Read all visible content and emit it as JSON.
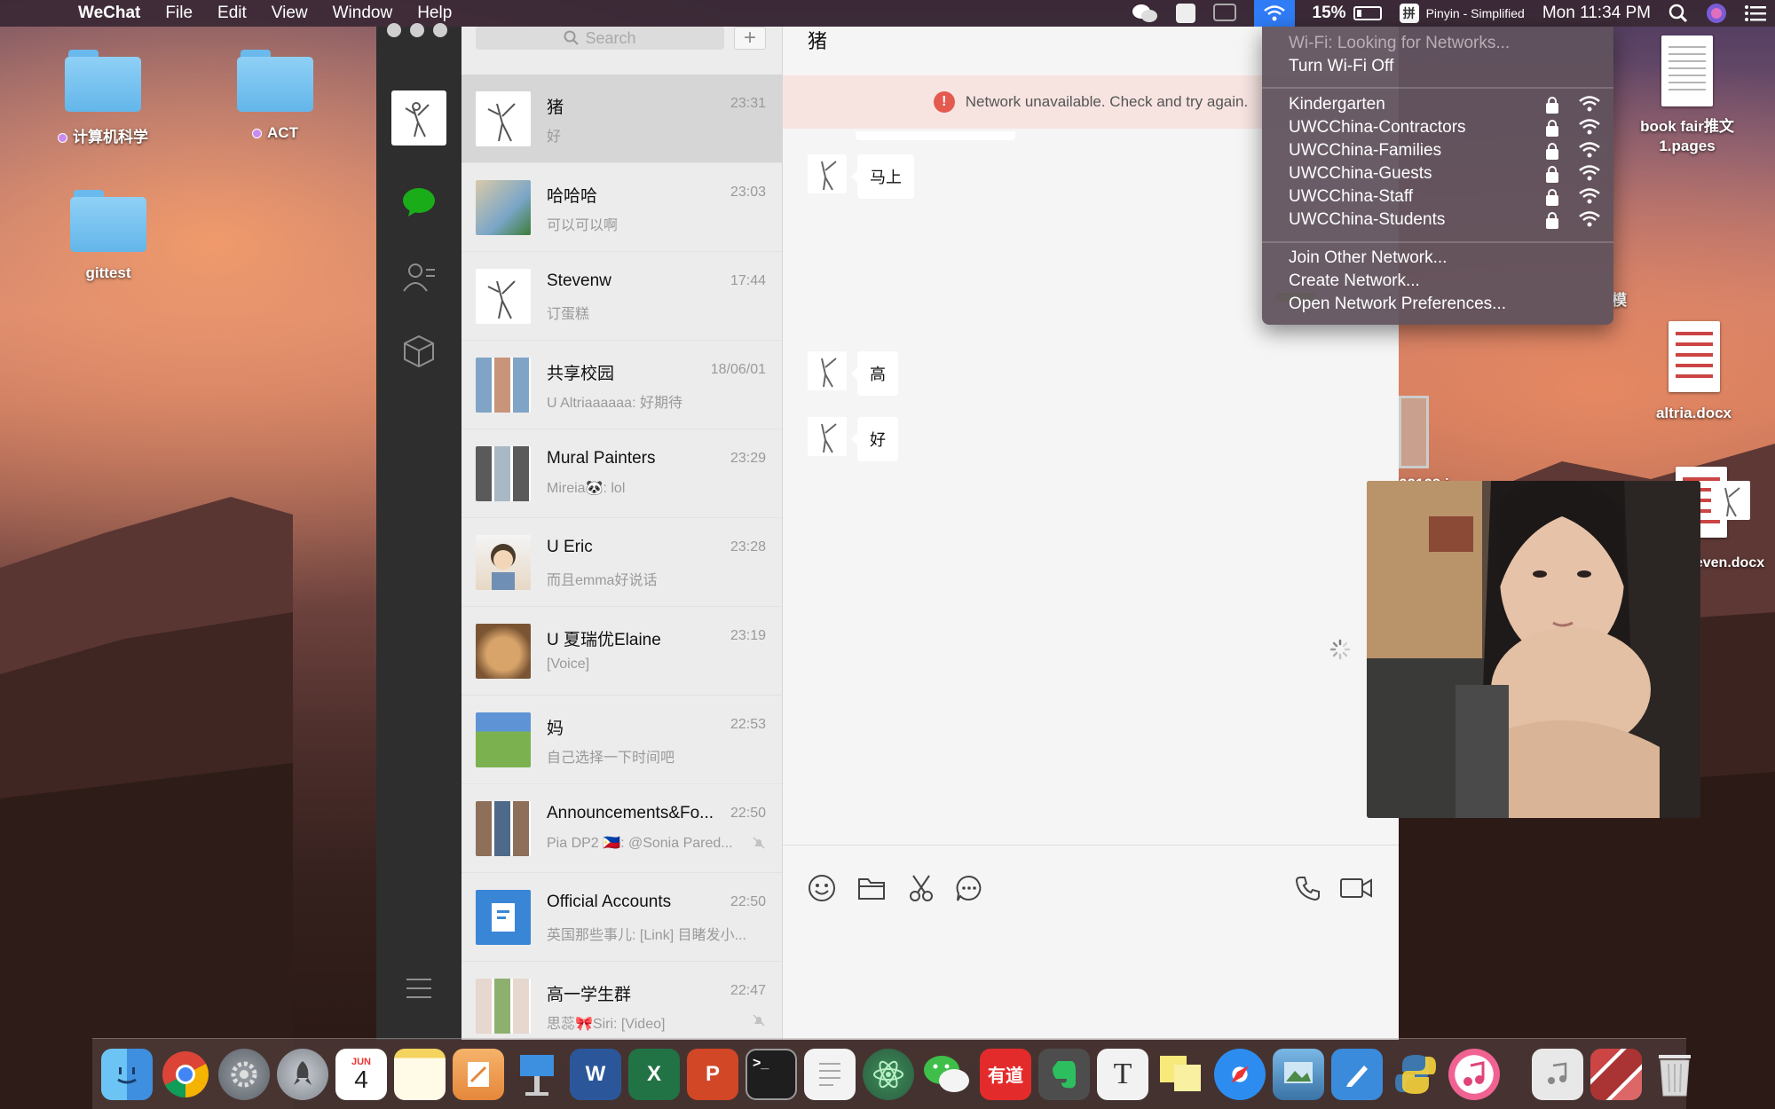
{
  "menubar": {
    "app_name": "WeChat",
    "menus": [
      "File",
      "Edit",
      "View",
      "Window",
      "Help"
    ],
    "battery": "15%",
    "input_method": "Pinyin - Simplified",
    "clock": "Mon 11:34 PM"
  },
  "desktop": {
    "icons": [
      {
        "label": "计算机科学",
        "kind": "folder",
        "tag": true
      },
      {
        "label": "ACT",
        "kind": "folder",
        "tag": true
      },
      {
        "label": "gittest",
        "kind": "folder",
        "tag": false
      },
      {
        "label": "book fair推文\n1.pages",
        "kind": "document"
      },
      {
        "label": "altria.docx",
        "kind": "document"
      },
      {
        "label": "二维码Steven.docx",
        "kind": "document"
      }
    ],
    "partial_labels": [
      "62169.j",
      "g",
      "模"
    ]
  },
  "wechat": {
    "search_placeholder": "Search",
    "add_label": "+",
    "conversations": [
      {
        "name": "猪",
        "time": "23:31",
        "preview": "好",
        "selected": true,
        "muted": false
      },
      {
        "name": "哈哈哈",
        "time": "23:03",
        "preview": "可以可以啊",
        "selected": false,
        "muted": false
      },
      {
        "name": "Stevenw",
        "time": "17:44",
        "preview": "订蛋糕",
        "selected": false,
        "muted": false
      },
      {
        "name": "共享校园",
        "time": "18/06/01",
        "preview": "U Altriaaaaaa: 好期待",
        "selected": false,
        "muted": false
      },
      {
        "name": "Mural Painters",
        "time": "23:29",
        "preview": "Mireia🐼: lol",
        "selected": false,
        "muted": false
      },
      {
        "name": "U Eric",
        "time": "23:28",
        "preview": "而且emma好说话",
        "selected": false,
        "muted": false
      },
      {
        "name": "U 夏瑞优Elaine",
        "time": "23:19",
        "preview": "[Voice]",
        "selected": false,
        "muted": false
      },
      {
        "name": "妈",
        "time": "22:53",
        "preview": "自己选择一下时间吧",
        "selected": false,
        "muted": false
      },
      {
        "name": "Announcements&Fo...",
        "time": "22:50",
        "preview": "Pia DP2 🇵🇭: @Sonia Pared...",
        "selected": false,
        "muted": true
      },
      {
        "name": "Official Accounts",
        "time": "22:50",
        "preview": "英国那些事儿: [Link] 目睹发小...",
        "selected": false,
        "muted": false
      },
      {
        "name": "高一学生群",
        "time": "22:47",
        "preview": "思蕊🎀Siri: [Video]",
        "selected": false,
        "muted": true
      }
    ],
    "chat": {
      "title": "猪",
      "banner": "Network unavailable. Check and try again.",
      "messages": [
        {
          "from": "other",
          "text": "马上"
        },
        {
          "from": "other",
          "text": "高"
        },
        {
          "from": "other",
          "text": "好"
        },
        {
          "from": "me",
          "type": "image"
        }
      ]
    }
  },
  "wifi_menu": {
    "status": "Wi-Fi: Looking for Networks...",
    "toggle": "Turn Wi-Fi Off",
    "networks": [
      "Kindergarten",
      "UWCChina-Contractors",
      "UWCChina-Families",
      "UWCChina-Guests",
      "UWCChina-Staff",
      "UWCChina-Students"
    ],
    "join_other": "Join Other Network...",
    "create": "Create Network...",
    "preferences": "Open Network Preferences..."
  },
  "dock": {
    "apps": [
      "finder-icon",
      "chrome-icon",
      "system-preferences-icon",
      "launchpad-icon",
      "calendar-icon",
      "notes-icon",
      "pages-icon",
      "keynote-icon",
      "word-icon",
      "excel-icon",
      "powerpoint-icon",
      "terminal-icon",
      "textedit-icon",
      "atom-icon",
      "wechat-icon",
      "youdao-icon",
      "evernote-icon",
      "typora-icon",
      "stickies-icon",
      "safari-icon",
      "preview-icon",
      "notability-icon",
      "python-icon",
      "itunes-icon",
      "music-folder-icon",
      "photos-stack-icon",
      "trash-icon"
    ],
    "calendar_month": "JUN",
    "calendar_day": "4",
    "youdao_label": "有道"
  },
  "colors": {
    "wechat_green": "#1aad19",
    "wifi_highlight": "#2f7cf6",
    "error_red": "#e45a4f"
  }
}
